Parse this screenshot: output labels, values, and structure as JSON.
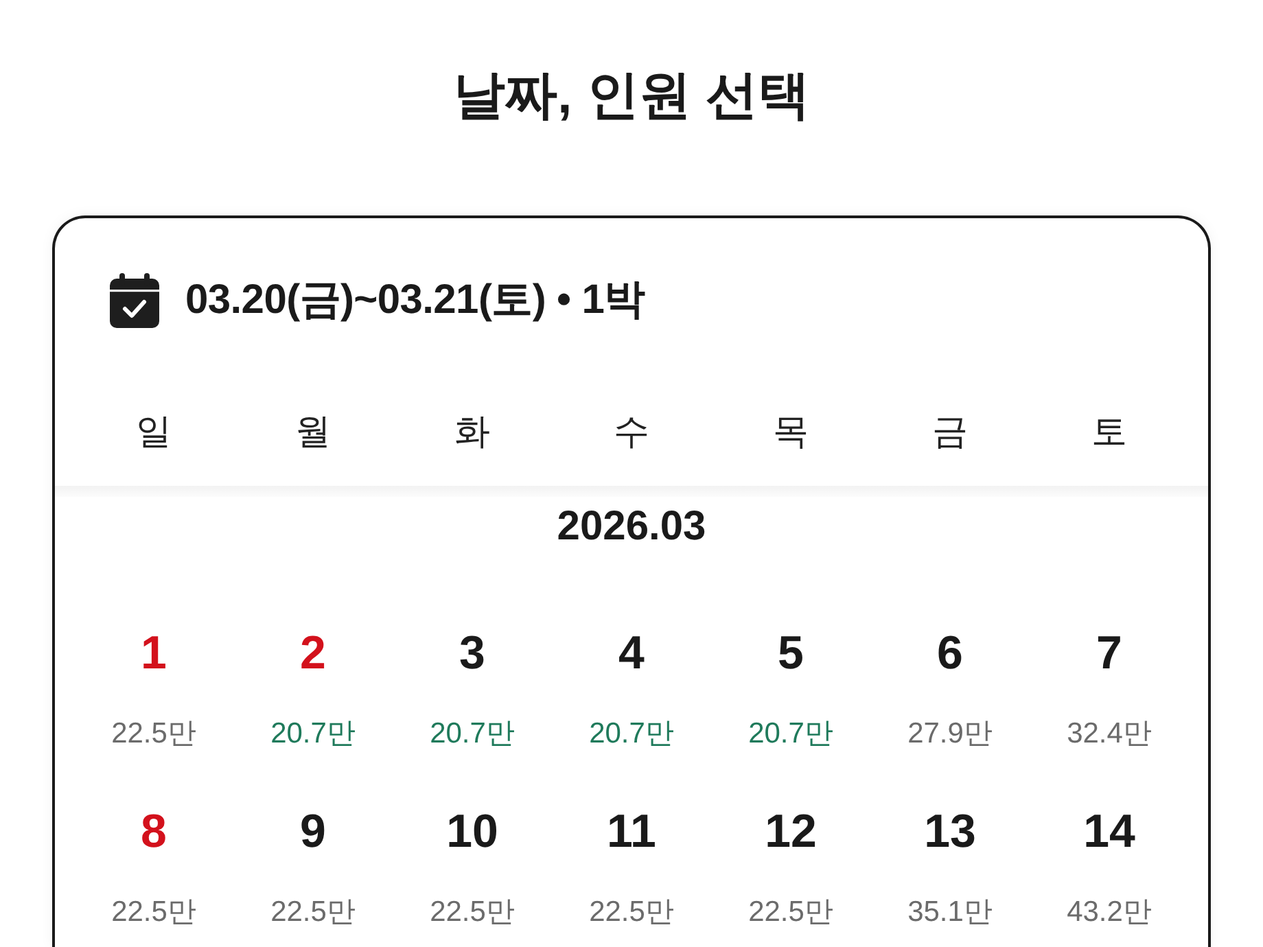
{
  "page": {
    "title": "날짜, 인원 선택"
  },
  "stay": {
    "range": "03.20(금)~03.21(토) • 1박"
  },
  "weekdays": [
    "일",
    "월",
    "화",
    "수",
    "목",
    "금",
    "토"
  ],
  "months": [
    {
      "label": "2026.03",
      "weeks": [
        {
          "days": [
            {
              "day": "1",
              "price": "22.5만",
              "holiday": true,
              "low_price": false
            },
            {
              "day": "2",
              "price": "20.7만",
              "holiday": true,
              "low_price": true
            },
            {
              "day": "3",
              "price": "20.7만",
              "holiday": false,
              "low_price": true
            },
            {
              "day": "4",
              "price": "20.7만",
              "holiday": false,
              "low_price": true
            },
            {
              "day": "5",
              "price": "20.7만",
              "holiday": false,
              "low_price": true
            },
            {
              "day": "6",
              "price": "27.9만",
              "holiday": false,
              "low_price": false
            },
            {
              "day": "7",
              "price": "32.4만",
              "holiday": false,
              "low_price": false
            }
          ]
        },
        {
          "days": [
            {
              "day": "8",
              "price": "22.5만",
              "holiday": true,
              "low_price": false
            },
            {
              "day": "9",
              "price": "22.5만",
              "holiday": false,
              "low_price": false
            },
            {
              "day": "10",
              "price": "22.5만",
              "holiday": false,
              "low_price": false
            },
            {
              "day": "11",
              "price": "22.5만",
              "holiday": false,
              "low_price": false
            },
            {
              "day": "12",
              "price": "22.5만",
              "holiday": false,
              "low_price": false
            },
            {
              "day": "13",
              "price": "35.1만",
              "holiday": false,
              "low_price": false
            },
            {
              "day": "14",
              "price": "43.2만",
              "holiday": false,
              "low_price": false
            }
          ]
        }
      ]
    }
  ]
}
